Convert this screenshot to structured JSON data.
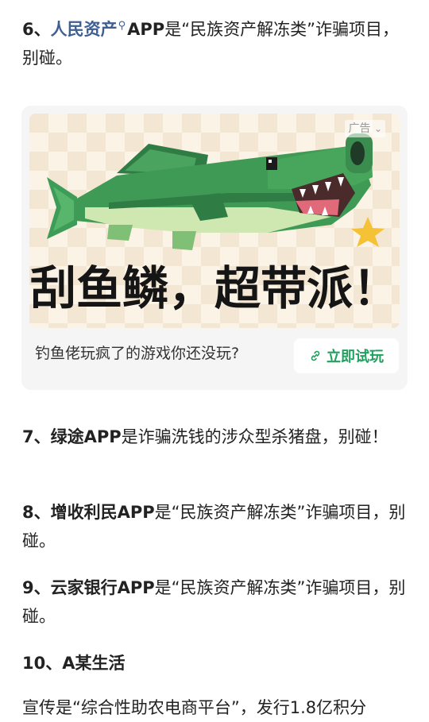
{
  "items": [
    {
      "num": "6、",
      "name": "人民资产",
      "search_glyph": "⚲",
      "rest_bold": "APP",
      "rest": "是“民族资产解冻类”诈骗项目，别碰。"
    },
    {
      "num": "7、",
      "name": "绿途APP",
      "rest": "是诈骗洗钱的涉众型杀猪盘，别碰！"
    },
    {
      "num": "8、",
      "name": "增收利民APP",
      "rest": "是“民族资产解冻类”诈骗项目，别碰。"
    },
    {
      "num": "9、",
      "name": "云家银行APP",
      "rest": "是“民族资产解冻类”诈骗项目，别碰。"
    },
    {
      "num": "10、",
      "name": "A某生活",
      "rest": ""
    }
  ],
  "partial_line": "宣传是“综合性助农电商平台”，发行1.8亿积分",
  "ad": {
    "label": "广告",
    "label_icon": "chevron-down-icon",
    "image_text": "刮鱼鳞，超带派！",
    "description": "钓鱼佬玩疯了的游戏你还没玩?",
    "cta": "立即试玩",
    "cta_icon": "link-icon",
    "accent_color": "#21a060"
  }
}
